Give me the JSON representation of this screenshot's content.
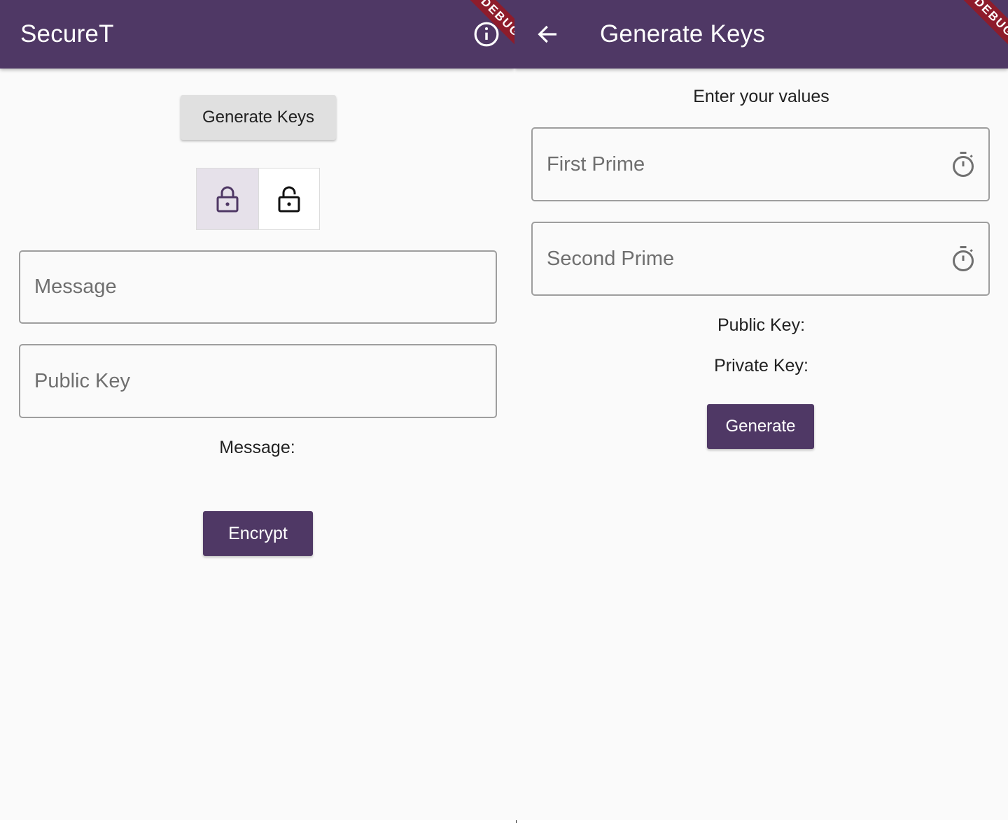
{
  "colors": {
    "primary": "#4f3865",
    "background": "#fafafa",
    "debug_banner": "#8e1c2b",
    "secondary_button": "#e0e0e0"
  },
  "main_screen": {
    "title": "SecureT",
    "info_icon": "info-circle-icon",
    "debug_banner": "DEBUG",
    "generate_keys_label": "Generate Keys",
    "mode_toggle": [
      {
        "icon": "lock-icon",
        "selected": true
      },
      {
        "icon": "unlock-icon",
        "selected": false
      }
    ],
    "message_field": {
      "placeholder": "Message",
      "value": ""
    },
    "public_key_field": {
      "placeholder": "Public Key",
      "value": ""
    },
    "output_label": "Message:",
    "encrypt_label": "Encrypt"
  },
  "generate_screen": {
    "title": "Generate Keys",
    "back_icon": "arrow-back-icon",
    "debug_banner": "DEBUG",
    "instruction": "Enter your values",
    "first_prime": {
      "placeholder": "First Prime",
      "value": "",
      "icon": "timer-icon"
    },
    "second_prime": {
      "placeholder": "Second Prime",
      "value": "",
      "icon": "timer-icon"
    },
    "public_key_label": "Public Key:",
    "private_key_label": "Private Key:",
    "generate_label": "Generate"
  }
}
